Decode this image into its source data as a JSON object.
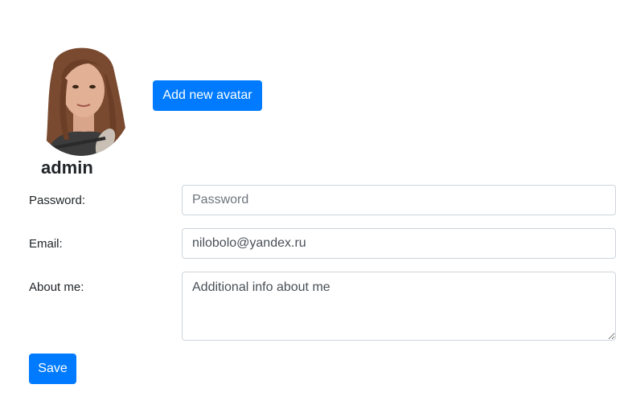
{
  "profile": {
    "username": "admin",
    "add_avatar_label": "Add new avatar"
  },
  "form": {
    "password": {
      "label": "Password:",
      "placeholder": "Password",
      "value": ""
    },
    "email": {
      "label": "Email:",
      "placeholder": "",
      "value": "nilobolo@yandex.ru"
    },
    "about": {
      "label": "About me:",
      "placeholder": "",
      "value": "Additional info about me"
    },
    "save_label": "Save"
  },
  "colors": {
    "primary": "#007bff",
    "border": "#ced4da",
    "text": "#212529"
  },
  "icons": {
    "avatar": "user-photo"
  }
}
